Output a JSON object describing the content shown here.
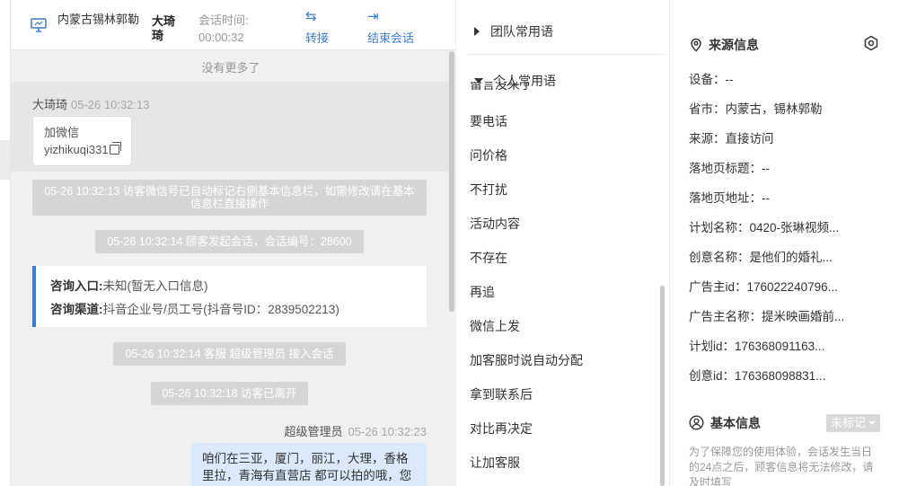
{
  "header": {
    "location": "内蒙古锡林郭勒",
    "visitor_name": "大琦琦",
    "session_time_label": "会话时间:",
    "session_time": "00:00:32",
    "transfer_label": "转接",
    "end_label": "结束会话"
  },
  "chat": {
    "no_more": "没有更多了",
    "visitor_name": "大琦琦",
    "visitor_time": "05-26 10:32:13",
    "visitor_msg_line1": "加微信",
    "visitor_msg_line2": "yizhikuqi331",
    "sys1": "05-26 10:32:13 访客微信号已自动标记右侧基本信息栏，如需修改请在基本信息栏直接操作",
    "sys2": "05-26 10:32:14 顾客发起会话，会话编号：28600",
    "consult_entry_label": "咨询入口:",
    "consult_entry_value": "未知(暂无入口信息)",
    "consult_channel_label": "咨询渠道:",
    "consult_channel_value": "抖音企业号/员工号(抖音号ID：2839502213)",
    "sys3": "05-26 10:32:14 客服 超级管理员 接入会话",
    "sys4": "05-26 10:32:18 访客已离开",
    "agent_name": "超级管理员",
    "agent_time": "05-26 10:32:23",
    "agent_msg": "咱们在三亚，厦门，丽江，大理，香格里拉，青海有直营店 都可以拍的哦，您想了解哪个城市的呢？"
  },
  "phrases": {
    "team_label": "团队常用语",
    "personal_label": "个人常用语",
    "clipped_item": "留言没来了",
    "items": [
      "要电话",
      "问价格",
      "不打扰",
      "活动内容",
      "不存在",
      "再追",
      "微信上发",
      "加客服时说自动分配",
      "拿到联系后",
      "对比再决定",
      "让加客服"
    ]
  },
  "info": {
    "source_title": "来源信息",
    "rows": [
      "设备：--",
      "省市：内蒙古，锡林郭勒",
      "来源：直接访问",
      "落地页标题：--",
      "落地页地址：--",
      "计划名称：0420-张琳视频...",
      "创意名称：是他们的婚礼...",
      "广告主id：176022240796...",
      "广告主名称：提米映画婚前...",
      "计划id：176368091163...",
      "创意id：176368098831..."
    ],
    "basic_title": "基本信息",
    "mark_label": "未标记",
    "basic_note": "为了保障您的使用体验，会话发生当日的24点之后，顾客信息将无法修改，请及时填写"
  },
  "colors": {
    "accent": "#3a7bd5",
    "agent_bubble": "#dce9fb",
    "system_msg": "#d6d6d6"
  }
}
